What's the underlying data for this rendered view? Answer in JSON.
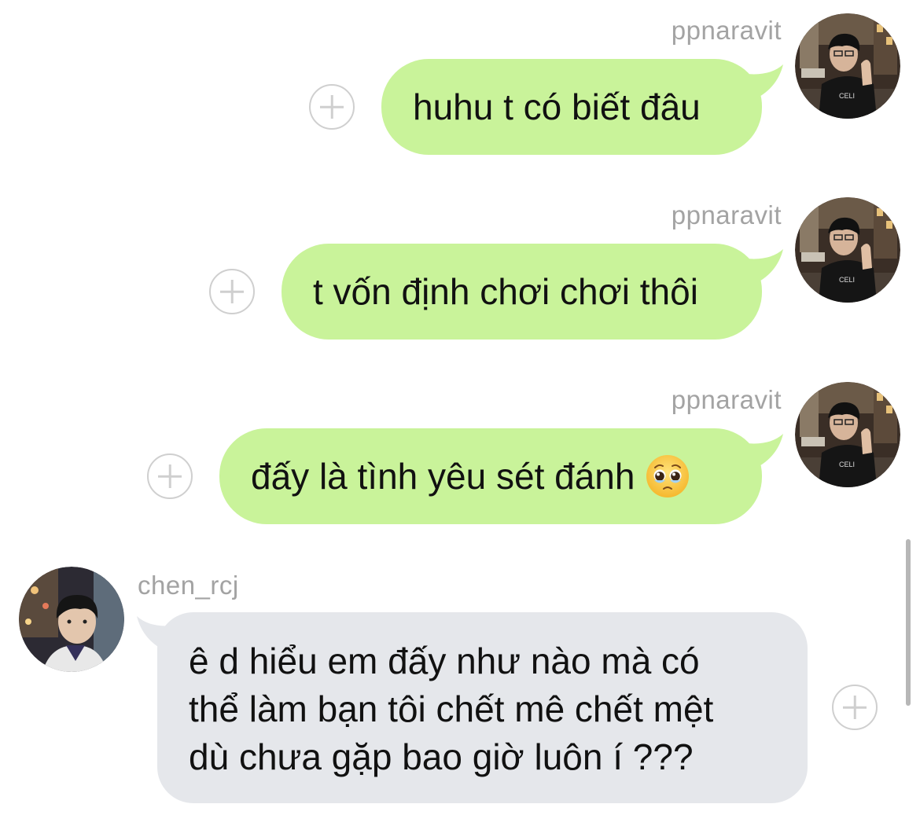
{
  "colors": {
    "outgoing_bubble": "#c9f39a",
    "incoming_bubble": "#e5e7eb",
    "sender_name": "#a3a3a3",
    "plus_icon": "#cfcfcf"
  },
  "messages": [
    {
      "direction": "outgoing",
      "sender": "ppnaravit",
      "text": "huhu t có biết đâu",
      "avatar_icon": "profile-photo-ppnaravit",
      "action_icon": "add-reaction-icon"
    },
    {
      "direction": "outgoing",
      "sender": "ppnaravit",
      "text": "t vốn định chơi chơi thôi",
      "avatar_icon": "profile-photo-ppnaravit",
      "action_icon": "add-reaction-icon"
    },
    {
      "direction": "outgoing",
      "sender": "ppnaravit",
      "text": "đấy là tình yêu sét đánh",
      "emoji": "pleading-face-icon",
      "avatar_icon": "profile-photo-ppnaravit",
      "action_icon": "add-reaction-icon"
    },
    {
      "direction": "incoming",
      "sender": "chen_rcj",
      "lines": [
        "ê d hiểu em đấy như nào mà có",
        "thể làm bạn tôi chết mê chết mệt",
        "dù chưa gặp bao giờ luôn í ???"
      ],
      "avatar_icon": "profile-photo-chen_rcj",
      "action_icon": "add-reaction-icon"
    }
  ]
}
